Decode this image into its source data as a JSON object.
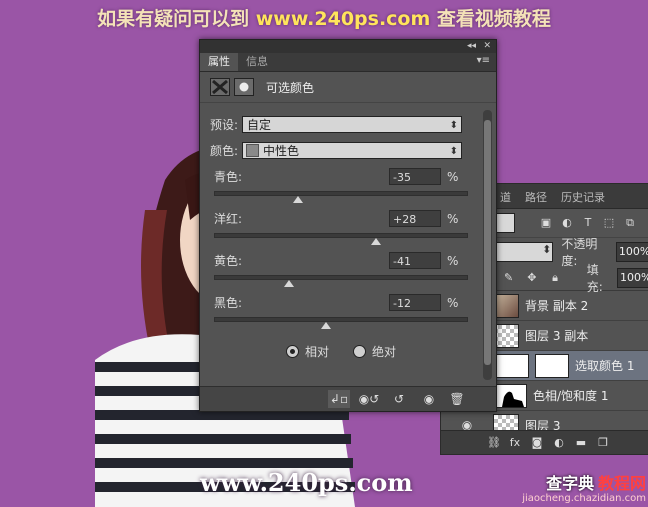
{
  "banner": {
    "left": "如果有疑问可以到",
    "url": "www.240ps.com",
    "right": "查看视频教程"
  },
  "watermark_bottom": "www.240ps.com",
  "watermark2": {
    "a": "查字典",
    "b": "教程网",
    "c": "jiaocheng.chazidian.com"
  },
  "properties": {
    "tabs": [
      "属性",
      "信息"
    ],
    "title": "可选颜色",
    "preset_label": "预设:",
    "preset_value": "自定",
    "color_label": "颜色:",
    "color_value": "中性色",
    "sliders": [
      {
        "label": "青色:",
        "value": "-35",
        "pct": "%",
        "fraction": 0.33
      },
      {
        "label": "洋红:",
        "value": "+28",
        "pct": "%",
        "fraction": 0.64
      },
      {
        "label": "黄色:",
        "value": "-41",
        "pct": "%",
        "fraction": 0.295
      },
      {
        "label": "黑色:",
        "value": "-12",
        "pct": "%",
        "fraction": 0.44
      }
    ],
    "radio": {
      "relative": "相对",
      "absolute": "绝对"
    }
  },
  "layers": {
    "tabs": [
      "道",
      "路径",
      "历史记录"
    ],
    "opacity_label": "不透明度:",
    "opacity_value": "100%",
    "fill_label": "填充:",
    "fill_value": "100%",
    "items": [
      {
        "name": "背景 副本 2"
      },
      {
        "name": "图层 3 副本"
      },
      {
        "name": "选取颜色 1"
      },
      {
        "name": "色相/饱和度 1"
      },
      {
        "name": "图层 3"
      }
    ]
  }
}
